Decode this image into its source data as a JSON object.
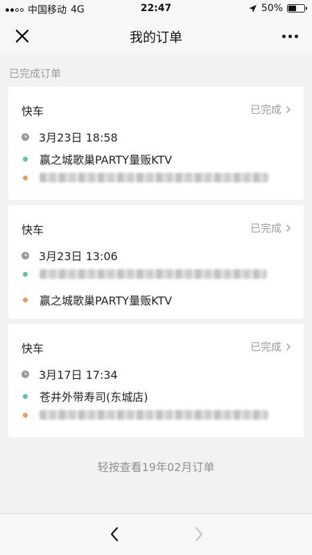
{
  "status_bar": {
    "carrier": "中国移动",
    "network": "4G",
    "time": "22:47",
    "battery_percent": "50%",
    "battery_level": 0.5
  },
  "nav": {
    "title": "我的订单",
    "close_icon": "close-icon",
    "more_icon": "more-icon"
  },
  "section_title": "已完成订单",
  "orders": [
    {
      "type": "快车",
      "status": "已完成",
      "time": "3月23日 18:58",
      "start": "赢之城歌巢PARTY量贩KTV",
      "end": ""
    },
    {
      "type": "快车",
      "status": "已完成",
      "time": "3月23日 13:06",
      "start": "",
      "end": "赢之城歌巢PARTY量贩KTV"
    },
    {
      "type": "快车",
      "status": "已完成",
      "time": "3月17日 17:34",
      "start": "苍井外带寿司(东城店)",
      "end": ""
    }
  ],
  "hint": "轻按查看19年02月订单",
  "colors": {
    "start_dot": "#5cc3a1",
    "end_dot": "#f09a5e",
    "clock": "#9a9a9a"
  }
}
